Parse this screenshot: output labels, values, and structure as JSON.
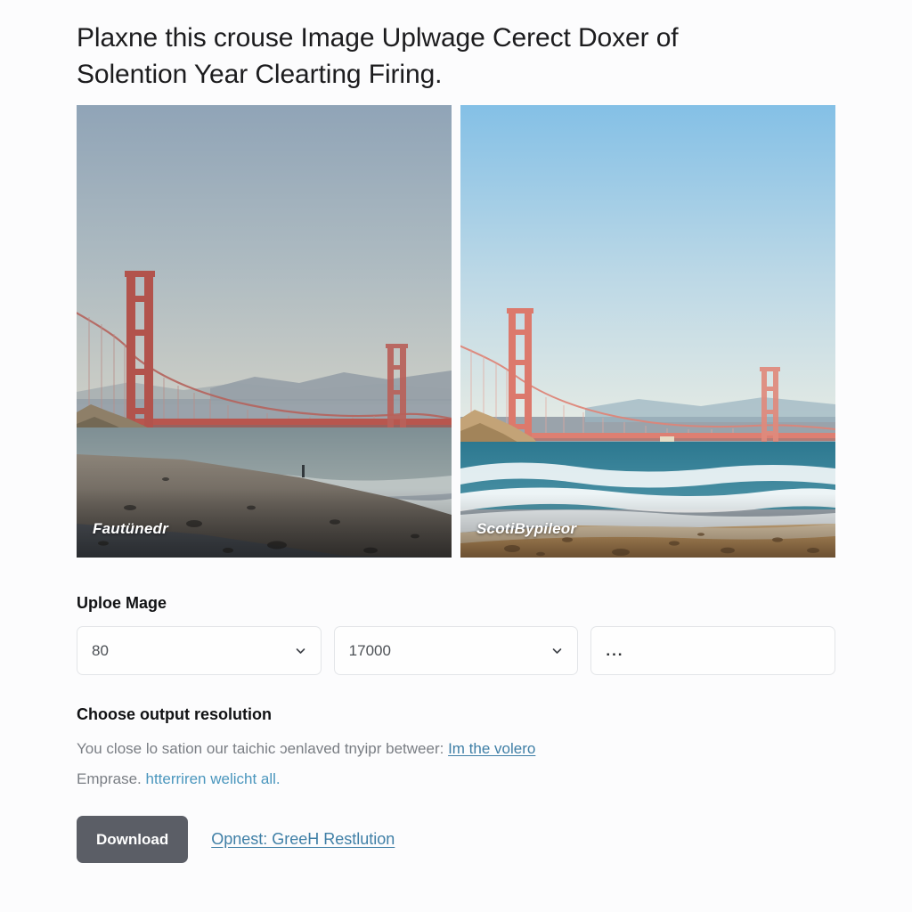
{
  "page": {
    "background": "#fcfcfd",
    "headline": "Plaxne this crouse Image Uplwage Cerect Doxer of Solention Year Clearting Firing."
  },
  "comparison": {
    "before": {
      "caption": "Fautünedr",
      "alt": "Golden Gate Bridge seen from Baker Beach, hazy muted original",
      "sky_top": "#93a6b8",
      "sky_bottom": "#c9ccc6",
      "bridge_color": "#c0544d",
      "sand_color": "#6f6a63",
      "water_color": "#8d9a9c"
    },
    "after": {
      "caption": "ScotiBypileor",
      "alt": "Golden Gate Bridge seen from Baker Beach, bright enhanced version",
      "sky_top": "#8ec4e4",
      "sky_bottom": "#dbe7ea",
      "bridge_color": "#e0796d",
      "sand_color": "#c79a68",
      "water_color": "#2f7f95"
    }
  },
  "upload": {
    "label": "Uploe Mage",
    "fields": [
      {
        "name": "quality-select",
        "value": "80",
        "icon": "chevron-down-icon",
        "has_chevron": true
      },
      {
        "name": "size-select",
        "value": "17000",
        "icon": "chevron-down-icon",
        "has_chevron": true
      },
      {
        "name": "more-options-field",
        "value": "...",
        "icon": "ellipsis-icon",
        "has_chevron": false
      }
    ]
  },
  "resolution": {
    "label": "Choose output resolution",
    "line1_prefix": "You close lo sation our taichic ɔenlaved tnyipr betweer:",
    "line1_link": "Im the volero",
    "line2_prefix": "Emprase.",
    "line2_link": "htterriren welicht all."
  },
  "actions": {
    "download_label": "Download",
    "reset_link": "Opnest: GreeH Restlution"
  },
  "colors": {
    "accent_link": "#3f7fa6",
    "button_bg": "#5b5e66",
    "text_primary": "#1c1c1e",
    "text_muted": "#7a7e84",
    "field_border": "#e3e5e8"
  }
}
